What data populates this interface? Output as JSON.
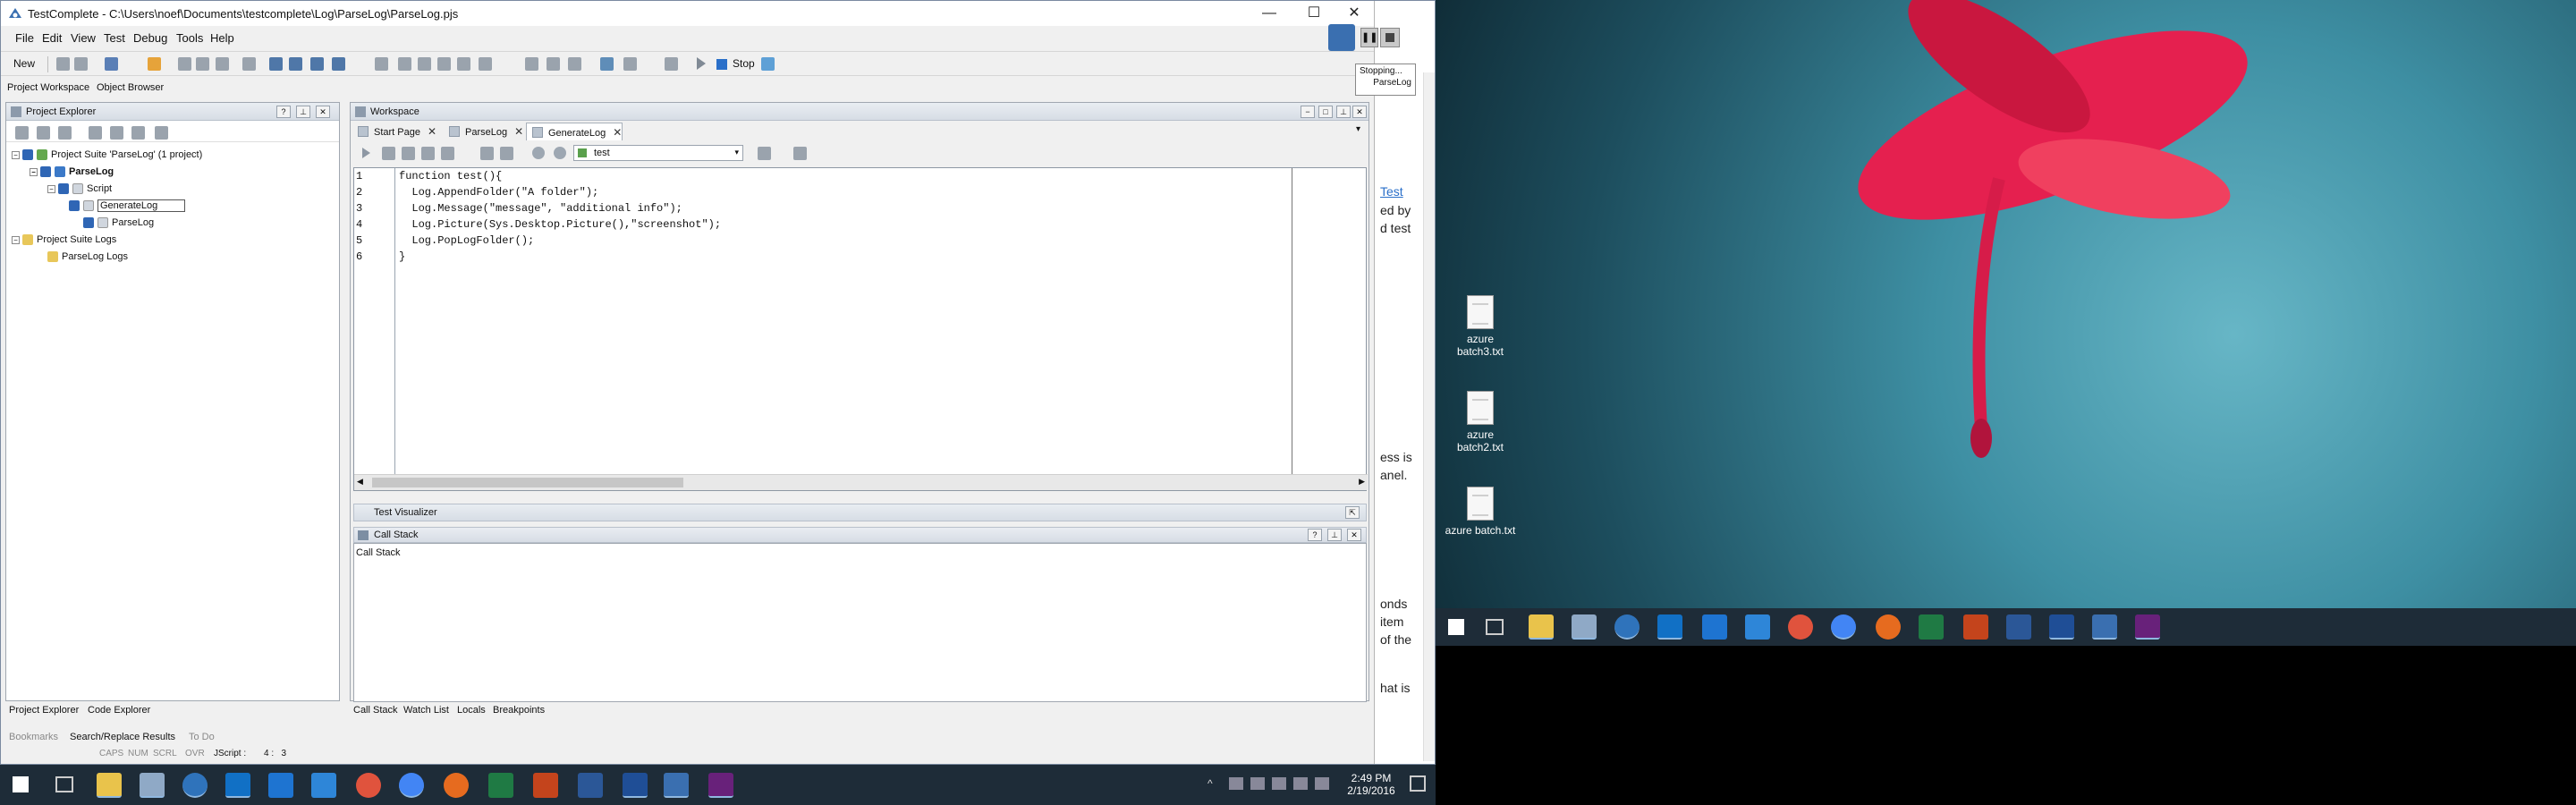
{
  "window": {
    "title": "TestComplete - C:\\Users\\noef\\Documents\\testcomplete\\Log\\ParseLog\\ParseLog.pjs",
    "minimize": "—",
    "maximize": "☐",
    "close": "✕"
  },
  "menu": [
    "File",
    "Edit",
    "View",
    "Test",
    "Debug",
    "Tools",
    "Help"
  ],
  "toolbar": {
    "new_label": "New",
    "stop_label": "Stop"
  },
  "workspace_tabs": [
    "Project Workspace",
    "Object Browser"
  ],
  "project_explorer": {
    "title": "Project Explorer",
    "tree": [
      "Project Suite 'ParseLog' (1 project)",
      "ParseLog",
      "Script",
      "GenerateLog",
      "ParseLog",
      "Project Suite Logs",
      "ParseLog Logs"
    ],
    "bottom_tabs": [
      "Project Explorer",
      "Code Explorer"
    ]
  },
  "workspace": {
    "title": "Workspace",
    "doc_tabs": [
      "Start Page",
      "ParseLog",
      "GenerateLog"
    ],
    "routine_select": "test",
    "code_lines": [
      "function test(){",
      "  Log.AppendFolder(\"A folder\");",
      "  Log.Message(\"message\", \"additional info\");",
      "  Log.Picture(Sys.Desktop.Picture(),\"screenshot\");",
      "  Log.PopLogFolder();",
      "}"
    ],
    "line_numbers": [
      "1",
      "2",
      "3",
      "4",
      "5",
      "6"
    ],
    "test_visualizer": "Test Visualizer",
    "call_stack_title": "Call Stack",
    "call_stack_column": "Call Stack",
    "bottom_tabs": [
      "Call Stack",
      "Watch List",
      "Locals",
      "Breakpoints"
    ]
  },
  "status_tabs": [
    "Bookmarks",
    "Search/Replace Results",
    "To Do"
  ],
  "statusbar": {
    "caps": "CAPS",
    "num": "NUM",
    "scrl": "SCRL",
    "ovr": "OVR",
    "language": "JScript :",
    "position": "4 :   3"
  },
  "stop_indicator": {
    "status": "Stopping...",
    "project": "ParseLog"
  },
  "background_document": [
    "Test",
    "ed by",
    "d test",
    "ess is",
    "anel.",
    "onds",
    "item",
    "of the",
    "hat is"
  ],
  "desktop_files": [
    {
      "name": "azure batch3.txt"
    },
    {
      "name": "azure batch2.txt"
    },
    {
      "name": "azure batch.txt"
    }
  ],
  "clock": {
    "time": "2:49 PM",
    "date": "2/19/2016"
  }
}
